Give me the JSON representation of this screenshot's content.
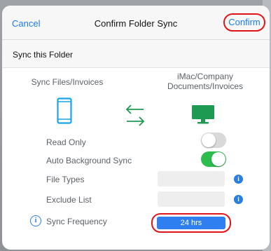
{
  "navbar": {
    "cancel_label": "Cancel",
    "title": "Confirm Folder Sync",
    "confirm_label": "Confirm"
  },
  "section": {
    "title": "Sync this Folder"
  },
  "sync": {
    "left_label": "Sync Files/Invoices",
    "right_label_line1": "iMac/Company",
    "right_label_line2": "Documents/Invoices",
    "left_icon": "tablet-icon",
    "middle_icon": "sync-arrows-icon",
    "right_icon": "monitor-icon"
  },
  "options": {
    "read_only_label": "Read Only",
    "read_only_on": false,
    "auto_sync_label": "Auto Background Sync",
    "auto_sync_on": true,
    "file_types_label": "File Types",
    "file_types_value": "",
    "exclude_list_label": "Exclude List",
    "exclude_list_value": "",
    "frequency_label": "Sync Frequency",
    "frequency_value": "24 hrs"
  },
  "colors": {
    "accent_blue": "#1a7cf2",
    "toggle_green": "#2dbd4e",
    "highlight_red": "#e0151b",
    "icon_green": "#1f9a52"
  }
}
